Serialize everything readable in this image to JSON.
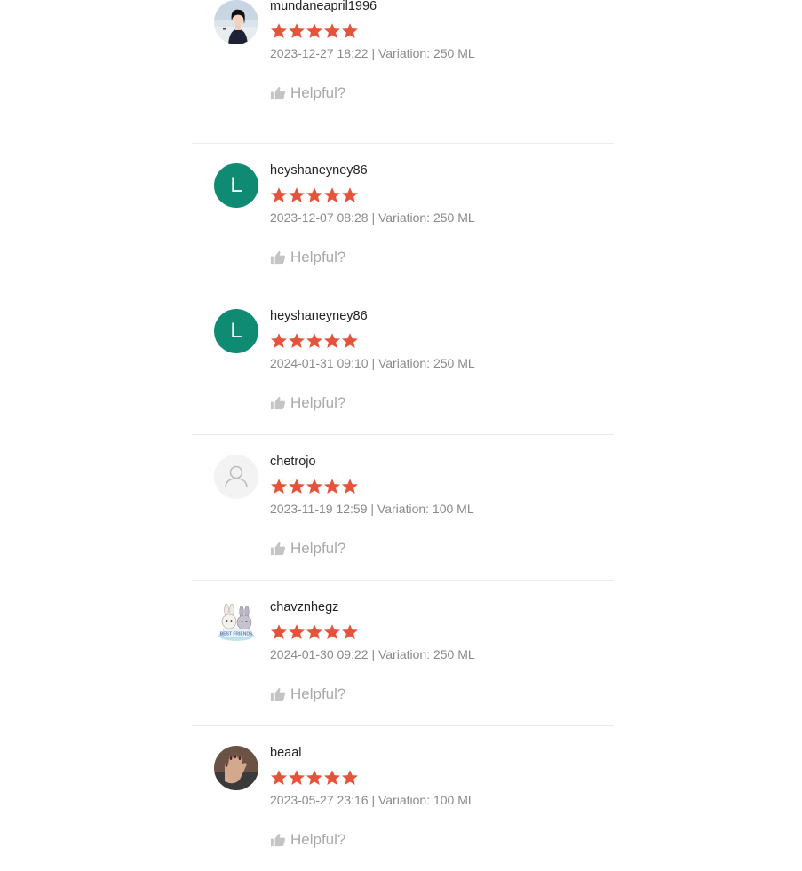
{
  "reviews": [
    {
      "username": "mundaneapril1996",
      "rating": 5,
      "date": "2023-12-27 18:22",
      "variation": "250 ML",
      "avatar": "photo-woman"
    },
    {
      "username": "heyshaneyney86",
      "rating": 5,
      "date": "2023-12-07 08:28",
      "variation": "250 ML",
      "avatar": "letter",
      "avatar_letter": "L"
    },
    {
      "username": "heyshaneyney86",
      "rating": 5,
      "date": "2024-01-31 09:10",
      "variation": "250 ML",
      "avatar": "letter",
      "avatar_letter": "L"
    },
    {
      "username": "chetrojo",
      "rating": 5,
      "date": "2023-11-19 12:59",
      "variation": "100 ML",
      "avatar": "default-user"
    },
    {
      "username": "chavznhegz",
      "rating": 5,
      "date": "2024-01-30 09:22",
      "variation": "250 ML",
      "avatar": "bunnies-best-friends",
      "avatar_text": "BEST FRIENDS"
    },
    {
      "username": "beaal",
      "rating": 5,
      "date": "2023-05-27 23:16",
      "variation": "100 ML",
      "avatar": "photo-hand"
    }
  ],
  "labels": {
    "helpful": "Helpful?",
    "variation_prefix": "Variation:",
    "separator": "|"
  },
  "colors": {
    "star": "#e5533a",
    "letter_avatar": "#0f8b74",
    "divider": "#ececec",
    "meta_text": "#8a8a8a",
    "helpful_text": "#a9a9a9"
  }
}
